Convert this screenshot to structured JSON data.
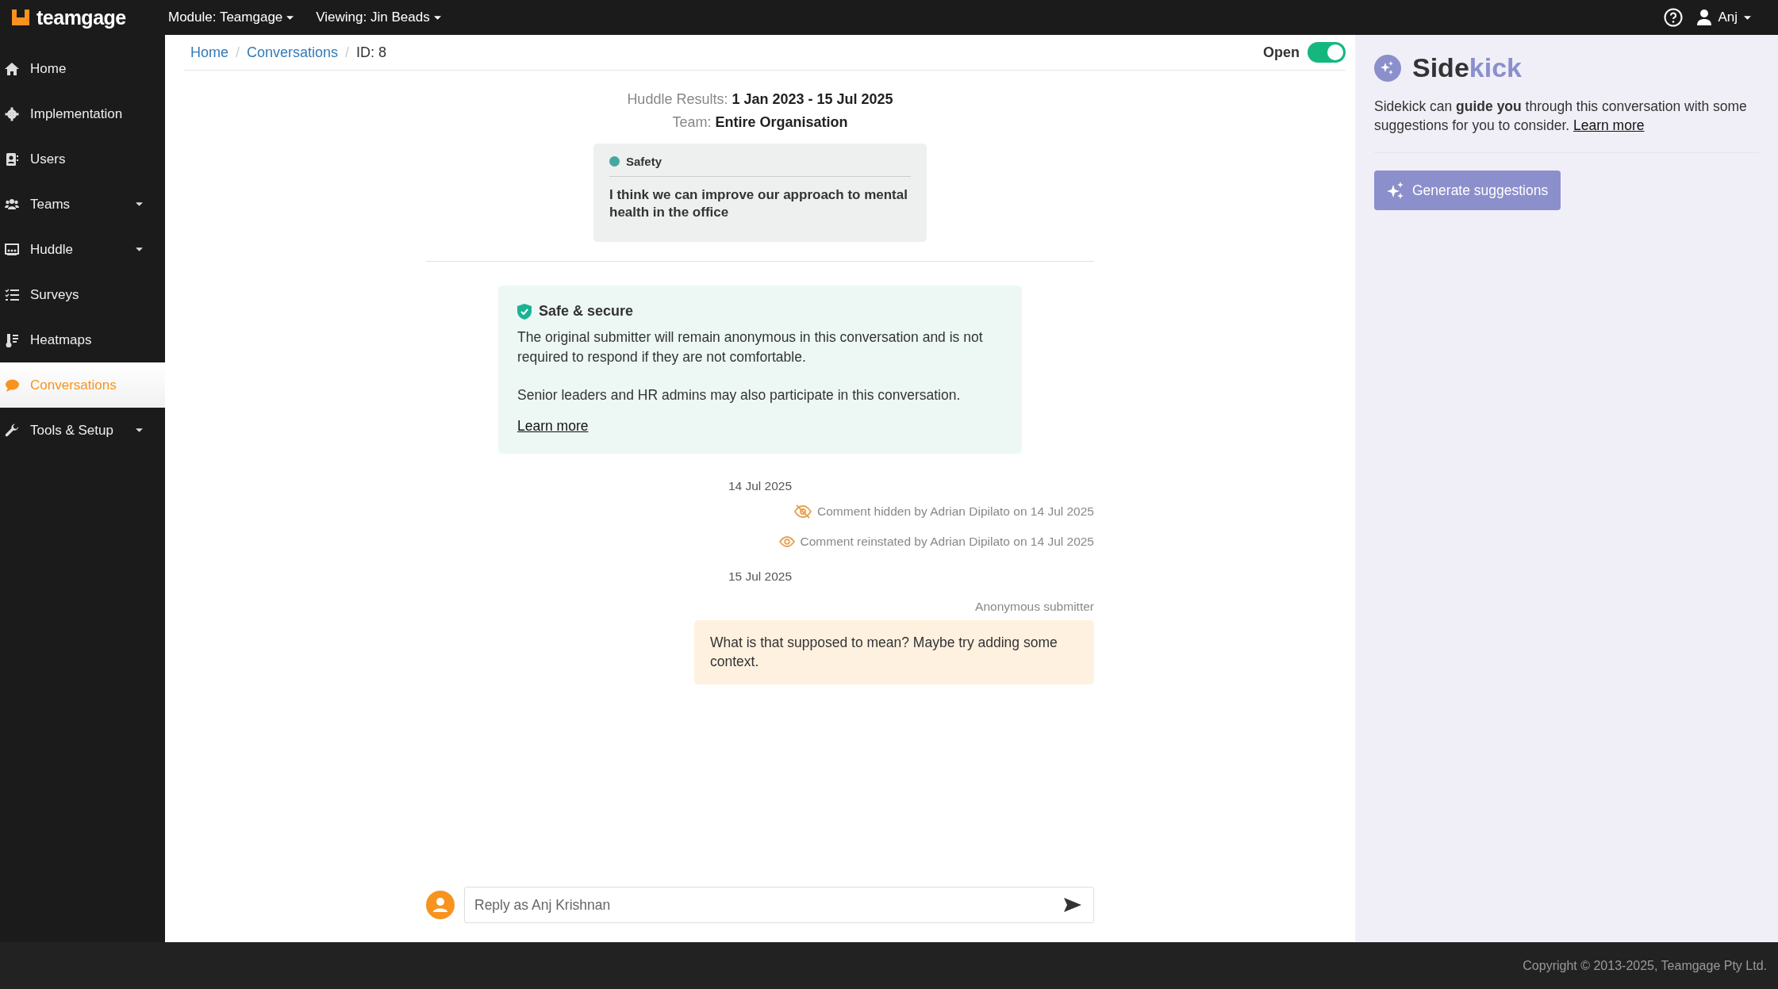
{
  "topbar": {
    "logo": "teamgage",
    "module": "Module: Teamgage",
    "viewing": "Viewing: Jin Beads",
    "user": "Anj"
  },
  "sidebar": {
    "items": [
      {
        "label": "Home",
        "selected": false,
        "expandable": false
      },
      {
        "label": "Implementation",
        "selected": false,
        "expandable": false
      },
      {
        "label": "Users",
        "selected": false,
        "expandable": false
      },
      {
        "label": "Teams",
        "selected": false,
        "expandable": true
      },
      {
        "label": "Huddle",
        "selected": false,
        "expandable": true
      },
      {
        "label": "Surveys",
        "selected": false,
        "expandable": false
      },
      {
        "label": "Heatmaps",
        "selected": false,
        "expandable": false
      },
      {
        "label": "Conversations",
        "selected": true,
        "expandable": false
      },
      {
        "label": "Tools & Setup",
        "selected": false,
        "expandable": true
      }
    ]
  },
  "breadcrumb_separators": [
    "/",
    "/"
  ],
  "breadcrumbs": [
    {
      "label": "Home",
      "link": true
    },
    {
      "label": "Conversations",
      "link": true
    },
    {
      "label": "ID: 8",
      "link": false
    }
  ],
  "status": {
    "label": "Open",
    "on": true
  },
  "summary": {
    "results_label": "Huddle Results:",
    "results_value": "1 Jan 2023 - 15 Jul 2025",
    "team_label": "Team:",
    "team_value": "Entire Organisation"
  },
  "topic_card": {
    "category": "Safety",
    "color": "#45a8a0",
    "text": "I think we can improve our approach to mental health in the office"
  },
  "notice": {
    "title": "Safe & secure",
    "paragraphs": [
      "The original submitter will remain anonymous in this conversation and is not required to respond if they are not comfortable.",
      "Senior leaders and HR admins may also participate in this conversation."
    ],
    "link": "Learn more"
  },
  "timeline": [
    {
      "kind": "date",
      "text": "14 Jul 2025"
    },
    {
      "kind": "hidden",
      "text": "Comment hidden by Adrian Dipilato on 14 Jul 2025"
    },
    {
      "kind": "reinstated",
      "text": "Comment reinstated by Adrian Dipilato on 14 Jul 2025"
    },
    {
      "kind": "date",
      "text": "15 Jul 2025"
    },
    {
      "kind": "message",
      "author": "Anonymous submitter",
      "text": "What is that supposed to mean? Maybe try adding some context."
    }
  ],
  "reply": {
    "placeholder": "Reply as Anj Krishnan"
  },
  "sidekick": {
    "title": "Side",
    "title_accent": "kick",
    "description": "Sidekick can **guide you** through this conversation with some suggestions for you to consider.",
    "link": "Learn more",
    "button": "Generate suggestions"
  },
  "footer": "Copyright © 2013-2025, Teamgage Pty Ltd."
}
